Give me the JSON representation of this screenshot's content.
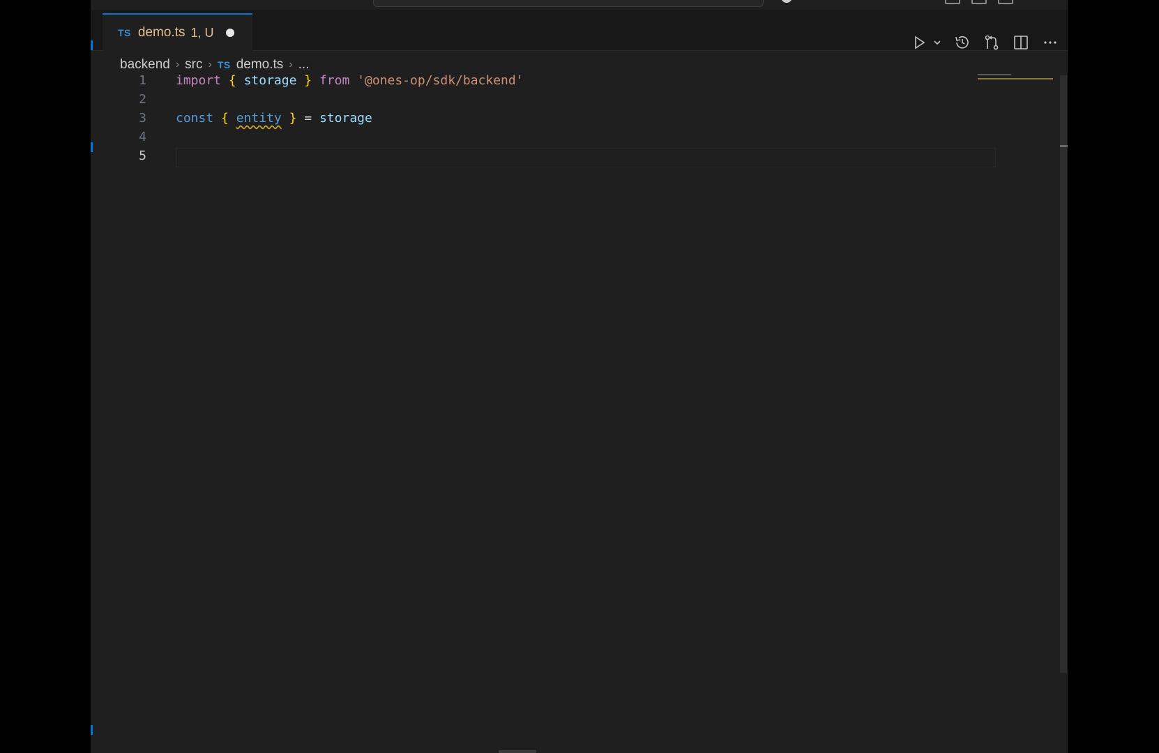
{
  "tab": {
    "icon": "TS",
    "filename": "demo.ts",
    "status": "1, U",
    "dirty_icon": "dot-circle-icon"
  },
  "toolbar": {
    "run_icon": "play-icon",
    "run_dropdown_icon": "chevron-down-icon",
    "timeline_icon": "history-icon",
    "compare_icon": "git-compare-icon",
    "split_icon": "split-editor-icon",
    "more_icon": "ellipsis-icon"
  },
  "breadcrumb": {
    "items": [
      "backend",
      "src",
      "demo.ts",
      "..."
    ],
    "file_icon": "TS",
    "separator": "›"
  },
  "editor": {
    "line_numbers": [
      "1",
      "2",
      "3",
      "4",
      "5"
    ],
    "active_line": 5,
    "lines": [
      {
        "tokens": [
          "import",
          " ",
          "{",
          " ",
          "storage",
          " ",
          "}",
          " ",
          "from",
          " ",
          "'@ones-op/sdk/backend'"
        ]
      },
      {
        "tokens": []
      },
      {
        "tokens": [
          "const",
          " ",
          "{",
          " ",
          "entity",
          " ",
          "}",
          " ",
          "=",
          " ",
          "storage"
        ]
      },
      {
        "tokens": []
      },
      {
        "tokens": []
      }
    ]
  },
  "colors": {
    "keyword_import": "#c586c0",
    "keyword_const": "#569cd6",
    "bracket": "#ffd700",
    "identifier": "#9cdcfe",
    "string": "#ce9178",
    "tab_modified": "#e2c08d",
    "accent": "#0078d4",
    "background": "#1f1f1f"
  }
}
